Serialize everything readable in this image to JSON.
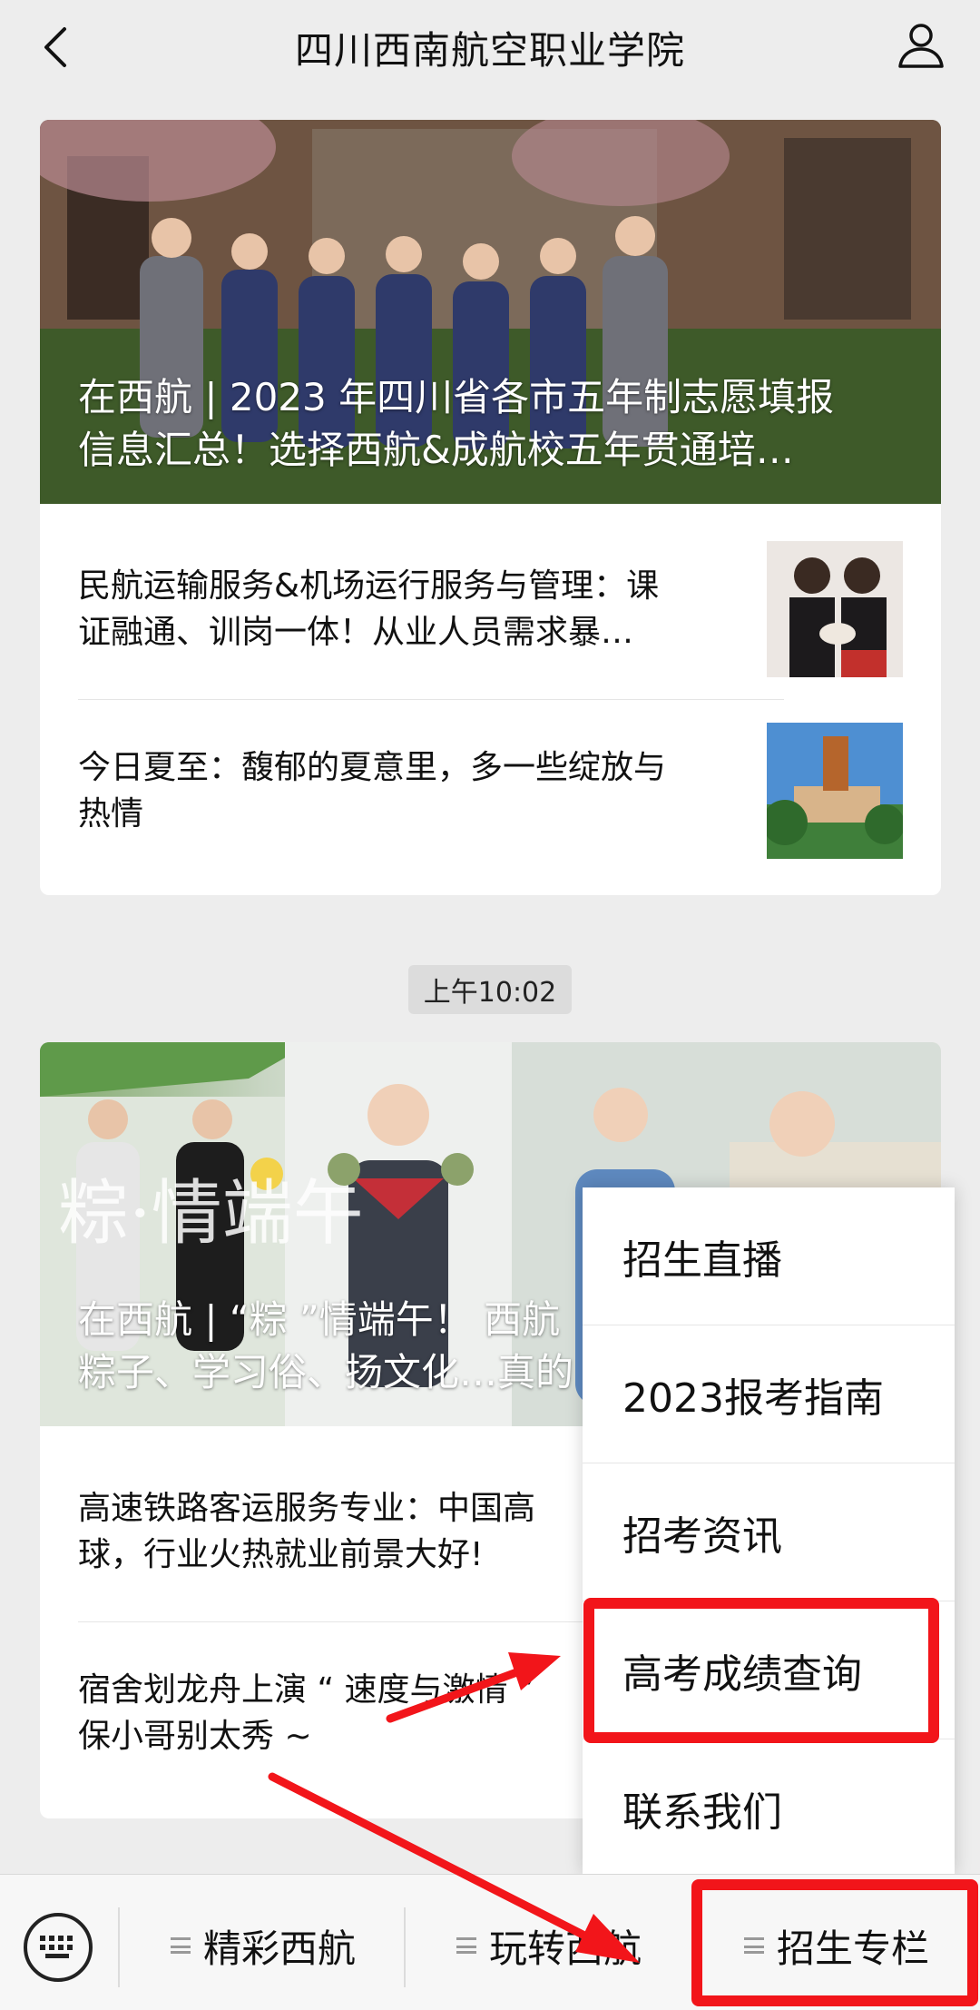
{
  "header": {
    "title": "四川西南航空职业学院",
    "back_icon": "chevron-left-icon",
    "profile_icon": "user-icon"
  },
  "articles": [
    {
      "headline_lines": [
        "在西航 | 2023 年四川省各市五年制志愿填报",
        "信息汇总！选择西航&成航校五年贯通培…"
      ],
      "items": [
        {
          "lines": [
            "民航运输服务&机场运行服务与管理：课",
            "证融通、训岗一体！从业人员需求暴…"
          ]
        },
        {
          "lines": [
            "今日夏至：馥郁的夏意里，多一些绽放与",
            "热情"
          ]
        }
      ]
    },
    {
      "headline_lines": [
        "在西航 | “粽 ”情端午！ 西航",
        "粽子、学习俗、扬文化…真的"
      ],
      "items": [
        {
          "lines": [
            "高速铁路客运服务专业：中国高",
            "球，行业火热就业前景大好!"
          ]
        },
        {
          "lines": [
            "宿舍划龙舟上演 “ 速度与激情 ”",
            "保小哥别太秀 ~"
          ]
        }
      ]
    }
  ],
  "timestamp": "上午10:02",
  "popup_menu": {
    "items": [
      "招生直播",
      "2023报考指南",
      "招考资讯",
      "高考成绩查询",
      "联系我们"
    ],
    "highlighted": "高考成绩查询"
  },
  "bottom_menu": {
    "keyboard_icon": "keyboard-icon",
    "tabs": [
      "精彩西航",
      "玩转西航",
      "招生专栏"
    ],
    "highlighted": "招生专栏"
  },
  "colors": {
    "highlight_red": "#f2151a",
    "background": "#ededed"
  }
}
